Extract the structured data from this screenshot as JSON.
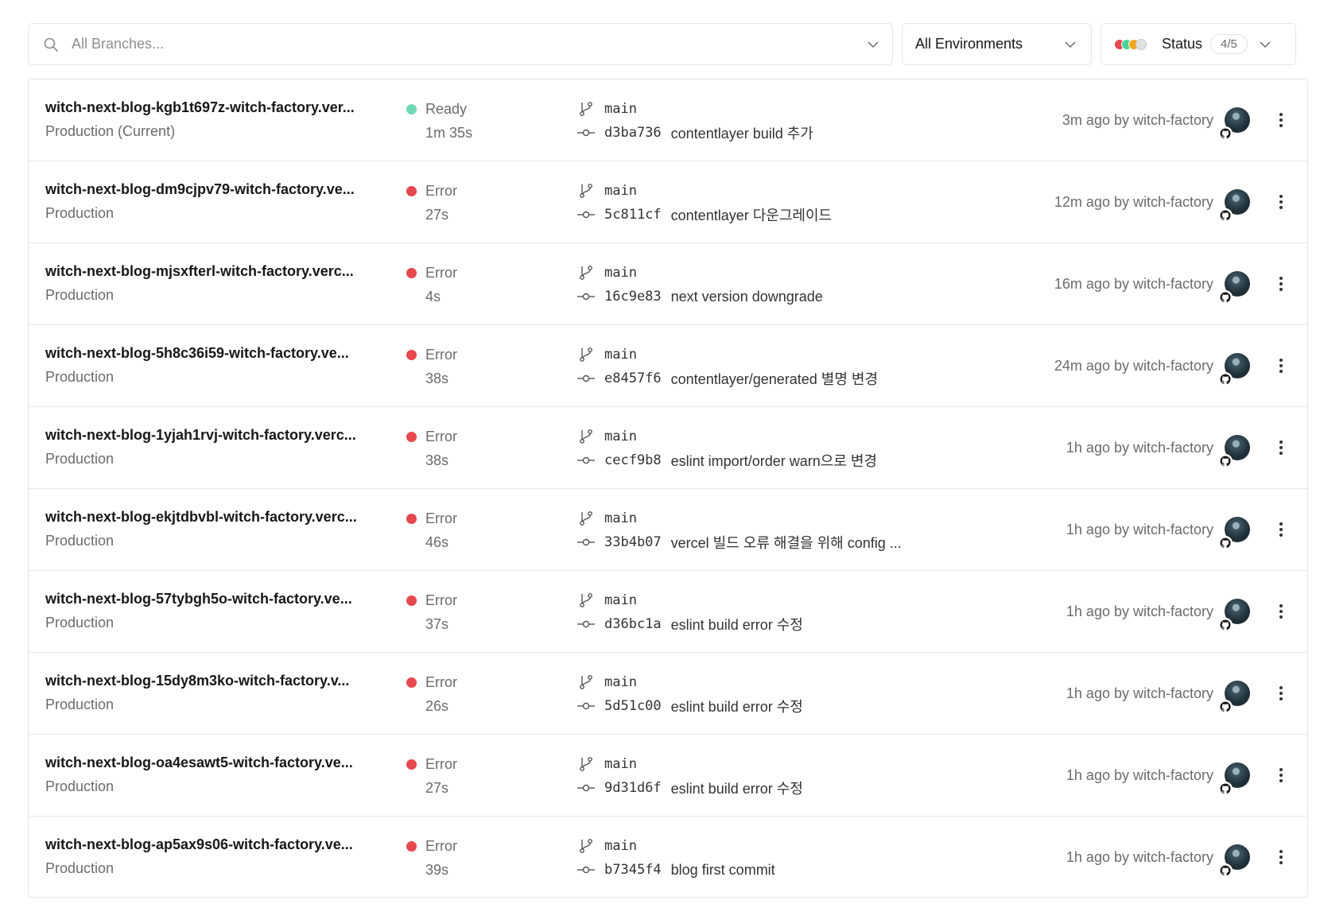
{
  "filters": {
    "search_placeholder": "All Branches...",
    "environment_label": "All Environments",
    "status_label": "Status",
    "status_count": "4/5",
    "status_dot_colors": [
      "#e5484d",
      "#45d39b",
      "#f5a524",
      "#e0e0e0"
    ]
  },
  "colors": {
    "ready": "#6fd9b1",
    "error": "#e5484d"
  },
  "deployments": [
    {
      "name": "witch-next-blog-kgb1t697z-witch-factory.ver...",
      "env": "Production (Current)",
      "status": "Ready",
      "status_color": "#6fd9b1",
      "duration": "1m 35s",
      "branch": "main",
      "hash": "d3ba736",
      "message": "contentlayer build 추가",
      "ago": "3m ago by witch-factory"
    },
    {
      "name": "witch-next-blog-dm9cjpv79-witch-factory.ve...",
      "env": "Production",
      "status": "Error",
      "status_color": "#e5484d",
      "duration": "27s",
      "branch": "main",
      "hash": "5c811cf",
      "message": "contentlayer 다운그레이드",
      "ago": "12m ago by witch-factory"
    },
    {
      "name": "witch-next-blog-mjsxfterl-witch-factory.verc...",
      "env": "Production",
      "status": "Error",
      "status_color": "#e5484d",
      "duration": "4s",
      "branch": "main",
      "hash": "16c9e83",
      "message": "next version downgrade",
      "ago": "16m ago by witch-factory"
    },
    {
      "name": "witch-next-blog-5h8c36i59-witch-factory.ve...",
      "env": "Production",
      "status": "Error",
      "status_color": "#e5484d",
      "duration": "38s",
      "branch": "main",
      "hash": "e8457f6",
      "message": "contentlayer/generated 별명 변경",
      "ago": "24m ago by witch-factory"
    },
    {
      "name": "witch-next-blog-1yjah1rvj-witch-factory.verc...",
      "env": "Production",
      "status": "Error",
      "status_color": "#e5484d",
      "duration": "38s",
      "branch": "main",
      "hash": "cecf9b8",
      "message": "eslint import/order warn으로 변경",
      "ago": "1h ago by witch-factory"
    },
    {
      "name": "witch-next-blog-ekjtdbvbl-witch-factory.verc...",
      "env": "Production",
      "status": "Error",
      "status_color": "#e5484d",
      "duration": "46s",
      "branch": "main",
      "hash": "33b4b07",
      "message": "vercel 빌드 오류 해결을 위해 config ...",
      "ago": "1h ago by witch-factory"
    },
    {
      "name": "witch-next-blog-57tybgh5o-witch-factory.ve...",
      "env": "Production",
      "status": "Error",
      "status_color": "#e5484d",
      "duration": "37s",
      "branch": "main",
      "hash": "d36bc1a",
      "message": "eslint build error 수정",
      "ago": "1h ago by witch-factory"
    },
    {
      "name": "witch-next-blog-15dy8m3ko-witch-factory.v...",
      "env": "Production",
      "status": "Error",
      "status_color": "#e5484d",
      "duration": "26s",
      "branch": "main",
      "hash": "5d51c00",
      "message": "eslint build error 수정",
      "ago": "1h ago by witch-factory"
    },
    {
      "name": "witch-next-blog-oa4esawt5-witch-factory.ve...",
      "env": "Production",
      "status": "Error",
      "status_color": "#e5484d",
      "duration": "27s",
      "branch": "main",
      "hash": "9d31d6f",
      "message": "eslint build error 수정",
      "ago": "1h ago by witch-factory"
    },
    {
      "name": "witch-next-blog-ap5ax9s06-witch-factory.ve...",
      "env": "Production",
      "status": "Error",
      "status_color": "#e5484d",
      "duration": "39s",
      "branch": "main",
      "hash": "b7345f4",
      "message": "blog first commit",
      "ago": "1h ago by witch-factory"
    }
  ]
}
